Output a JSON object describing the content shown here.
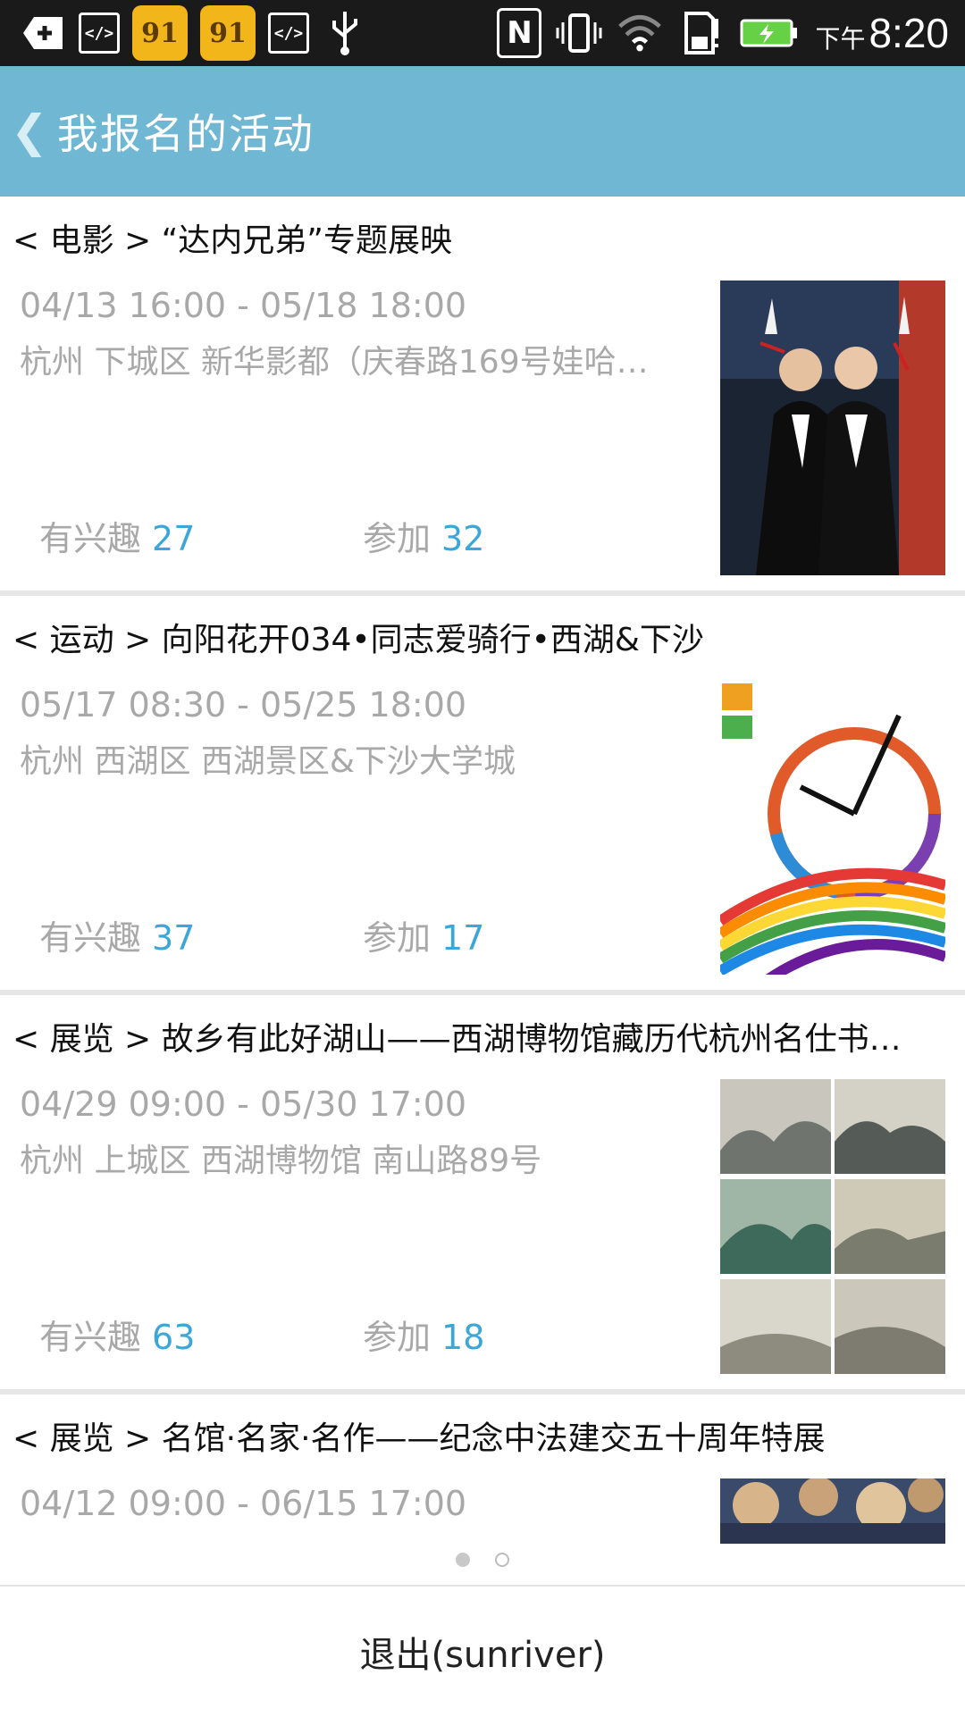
{
  "status_bar": {
    "time_prefix": "下午",
    "time": "8:20",
    "icons": [
      "add-icon",
      "dev-icon",
      "app-icon",
      "app-icon",
      "dev-icon",
      "usb-icon",
      "nfc-icon",
      "vibrate-icon",
      "wifi-icon",
      "sd-card-icon",
      "battery-icon"
    ]
  },
  "header": {
    "back_glyph": "❮",
    "title": "我报名的活动"
  },
  "items": [
    {
      "title": "< 电影 > “达内兄弟”专题展映",
      "time": "04/13 16:00 - 05/18 18:00",
      "location": "杭州 下城区 新华影都（庆春路169号娃哈…",
      "interest_label": "有兴趣",
      "interest_count": "27",
      "join_label": "参加",
      "join_count": "32"
    },
    {
      "title": "< 运动 > 向阳花开034•同志爱骑行•西湖&下沙",
      "time": "05/17 08:30 - 05/25 18:00",
      "location": "杭州 西湖区 西湖景区&下沙大学城",
      "interest_label": "有兴趣",
      "interest_count": "37",
      "join_label": "参加",
      "join_count": "17"
    },
    {
      "title": "< 展览 > 故乡有此好湖山——西湖博物馆藏历代杭州名仕书…",
      "time": "04/29 09:00 - 05/30 17:00",
      "location": "杭州 上城区 西湖博物馆 南山路89号",
      "interest_label": "有兴趣",
      "interest_count": "63",
      "join_label": "参加",
      "join_count": "18"
    },
    {
      "title": "< 展览 > 名馆·名家·名作——纪念中法建交五十周年特展",
      "time": "04/12 09:00 - 06/15 17:00",
      "location": "",
      "interest_label": "",
      "interest_count": "",
      "join_label": "",
      "join_count": ""
    }
  ],
  "footer": {
    "logout_label": "退出(sunriver)"
  }
}
